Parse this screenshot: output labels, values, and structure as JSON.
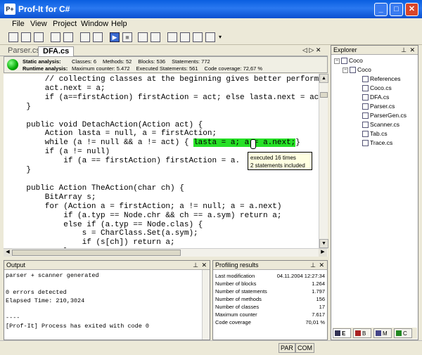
{
  "window": {
    "title": "Prof-It for C#",
    "app_icon": "P+",
    "min_icon": "_",
    "max_icon": "□",
    "close_icon": "✕"
  },
  "menu": [
    "File",
    "View",
    "Project",
    "Window",
    "Help"
  ],
  "toolbar": {
    "buttons": [
      "new-file-icon",
      "open-folder-icon",
      "save-icon",
      "window-icon",
      "window-icon",
      "panel-icon",
      "panel-icon",
      "run-icon",
      "stop-icon",
      "profile-icon",
      "profile-icon",
      "profile-icon",
      "profile-icon",
      "profile-icon"
    ],
    "overflow": "▾"
  },
  "editor_tabs": [
    "Parser.cs",
    "DFA.cs"
  ],
  "tab_nav": "◁ ▷ ✕",
  "status": {
    "static_label": "Static analysis:",
    "static": [
      "Classes: 6",
      "Methods: 52",
      "Blocks: 536",
      "Statements: 772"
    ],
    "runtime_label": "Runtime analysis:",
    "runtime": [
      "Maximum counter: 5.472",
      "Executed Statements: 561",
      "Code coverage: 72,67 %"
    ]
  },
  "code": {
    "l1": "        // collecting classes at the beginning gives better performa",
    "l2": "        act.next = a;",
    "l3": "        if (a==firstAction) firstAction = act; else lasta.next = act",
    "l4": "    }",
    "l5": "",
    "l6": "    public void DetachAction(Action act) {",
    "l7": "        Action lasta = null, a = firstAction;",
    "l8a": "        while (a != null && a != act) {",
    "l8b": "lasta = a; a = a.next;",
    "l8c": "}",
    "l9": "        if (a != null)",
    "l10": "            if (a == firstAction) firstAction = a.",
    "l11": "    }",
    "l12": "",
    "l13": "    public Action TheAction(char ch) {",
    "l14": "        BitArray s;",
    "l15": "        for (Action a = firstAction; a != null; a = a.next)",
    "l16": "            if (a.typ == Node.chr && ch == a.sym) return a;",
    "l17": "            else if (a.typ == Node.clas) {",
    "l18": "                s = CharClass.Set(a.sym);",
    "l19": "                if (s[ch]) return a;",
    "l20": "            }"
  },
  "tooltip": {
    "line1": "executed 16 times",
    "line2": "2 statements included"
  },
  "explorer": {
    "title": "Explorer",
    "pin": "⊥",
    "close": "✕",
    "root": "Coco",
    "project": "Coco",
    "files": [
      "References",
      "Coco.cs",
      "DFA.cs",
      "Parser.cs",
      "ParserGen.cs",
      "Scanner.cs",
      "Tab.cs",
      "Trace.cs"
    ],
    "tabs": [
      "E",
      "B",
      "M",
      "C"
    ]
  },
  "output": {
    "title": "Output",
    "text": "parser + scanner generated\n\n0 errors detected\nElapsed Time: 210,3024\n\n----\n[Prof-It] Process has exited with code 0"
  },
  "profiling": {
    "title": "Profiling results",
    "rows": [
      {
        "label": "Last modification",
        "value": "04.11.2004 12:27:34"
      },
      {
        "label": "Number of blocks",
        "value": "1.264"
      },
      {
        "label": "Number of statements",
        "value": "1.797"
      },
      {
        "label": "Number of methods",
        "value": "156"
      },
      {
        "label": "Number of classes",
        "value": "17"
      },
      {
        "label": "Maximum counter",
        "value": "7.617"
      },
      {
        "label": "Code coverage",
        "value": "70,01 %"
      }
    ]
  },
  "statusbar": {
    "par": "PAR",
    "com": "COM"
  }
}
